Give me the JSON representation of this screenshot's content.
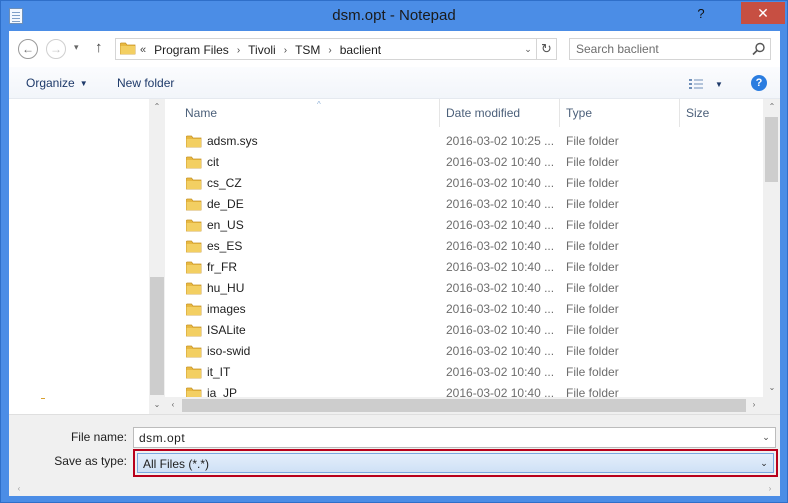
{
  "window": {
    "title": "dsm.opt - Notepad",
    "help_glyph": "?",
    "close_glyph": "✕"
  },
  "nav": {
    "back_glyph": "←",
    "forward_glyph": "→",
    "history_glyph": "▾",
    "up_glyph": "↑",
    "breadcrumb_prefix": "«",
    "breadcrumb": [
      "Program Files",
      "Tivoli",
      "TSM",
      "baclient"
    ],
    "breadcrumb_sep": "›",
    "dropdown_glyph": "⌄",
    "refresh_glyph": "↻",
    "search_placeholder": "Search baclient"
  },
  "toolbar": {
    "organize_label": "Organize",
    "organize_caret": "▼",
    "new_folder_label": "New folder",
    "view_caret": "▼",
    "help_glyph": "?"
  },
  "columns": {
    "name": "Name",
    "date": "Date modified",
    "type": "Type",
    "size": "Size",
    "sort_glyph": "^"
  },
  "files": [
    {
      "name": "adsm.sys",
      "date": "2016-03-02 10:25 ...",
      "type": "File folder"
    },
    {
      "name": "cit",
      "date": "2016-03-02 10:40 ...",
      "type": "File folder"
    },
    {
      "name": "cs_CZ",
      "date": "2016-03-02 10:40 ...",
      "type": "File folder"
    },
    {
      "name": "de_DE",
      "date": "2016-03-02 10:40 ...",
      "type": "File folder"
    },
    {
      "name": "en_US",
      "date": "2016-03-02 10:40 ...",
      "type": "File folder"
    },
    {
      "name": "es_ES",
      "date": "2016-03-02 10:40 ...",
      "type": "File folder"
    },
    {
      "name": "fr_FR",
      "date": "2016-03-02 10:40 ...",
      "type": "File folder"
    },
    {
      "name": "hu_HU",
      "date": "2016-03-02 10:40 ...",
      "type": "File folder"
    },
    {
      "name": "images",
      "date": "2016-03-02 10:40 ...",
      "type": "File folder"
    },
    {
      "name": "ISALite",
      "date": "2016-03-02 10:40 ...",
      "type": "File folder"
    },
    {
      "name": "iso-swid",
      "date": "2016-03-02 10:40 ...",
      "type": "File folder"
    },
    {
      "name": "it_IT",
      "date": "2016-03-02 10:40 ...",
      "type": "File folder"
    },
    {
      "name": "ja_JP",
      "date": "2016-03-02 10:40 ...",
      "type": "File folder"
    }
  ],
  "scroll": {
    "up_glyph": "⌃",
    "down_glyph": "⌄",
    "left_glyph": "‹",
    "right_glyph": "›"
  },
  "form": {
    "file_name_label": "File name:",
    "file_name_value": "dsm.opt",
    "save_type_label": "Save as type:",
    "save_type_value": "All Files (*.*)",
    "dropdown_glyph": "⌄"
  },
  "colors": {
    "window_border": "#4b8de6",
    "close_button": "#c74f42",
    "highlight_border": "#b8001c",
    "folder": "#e8b941"
  }
}
